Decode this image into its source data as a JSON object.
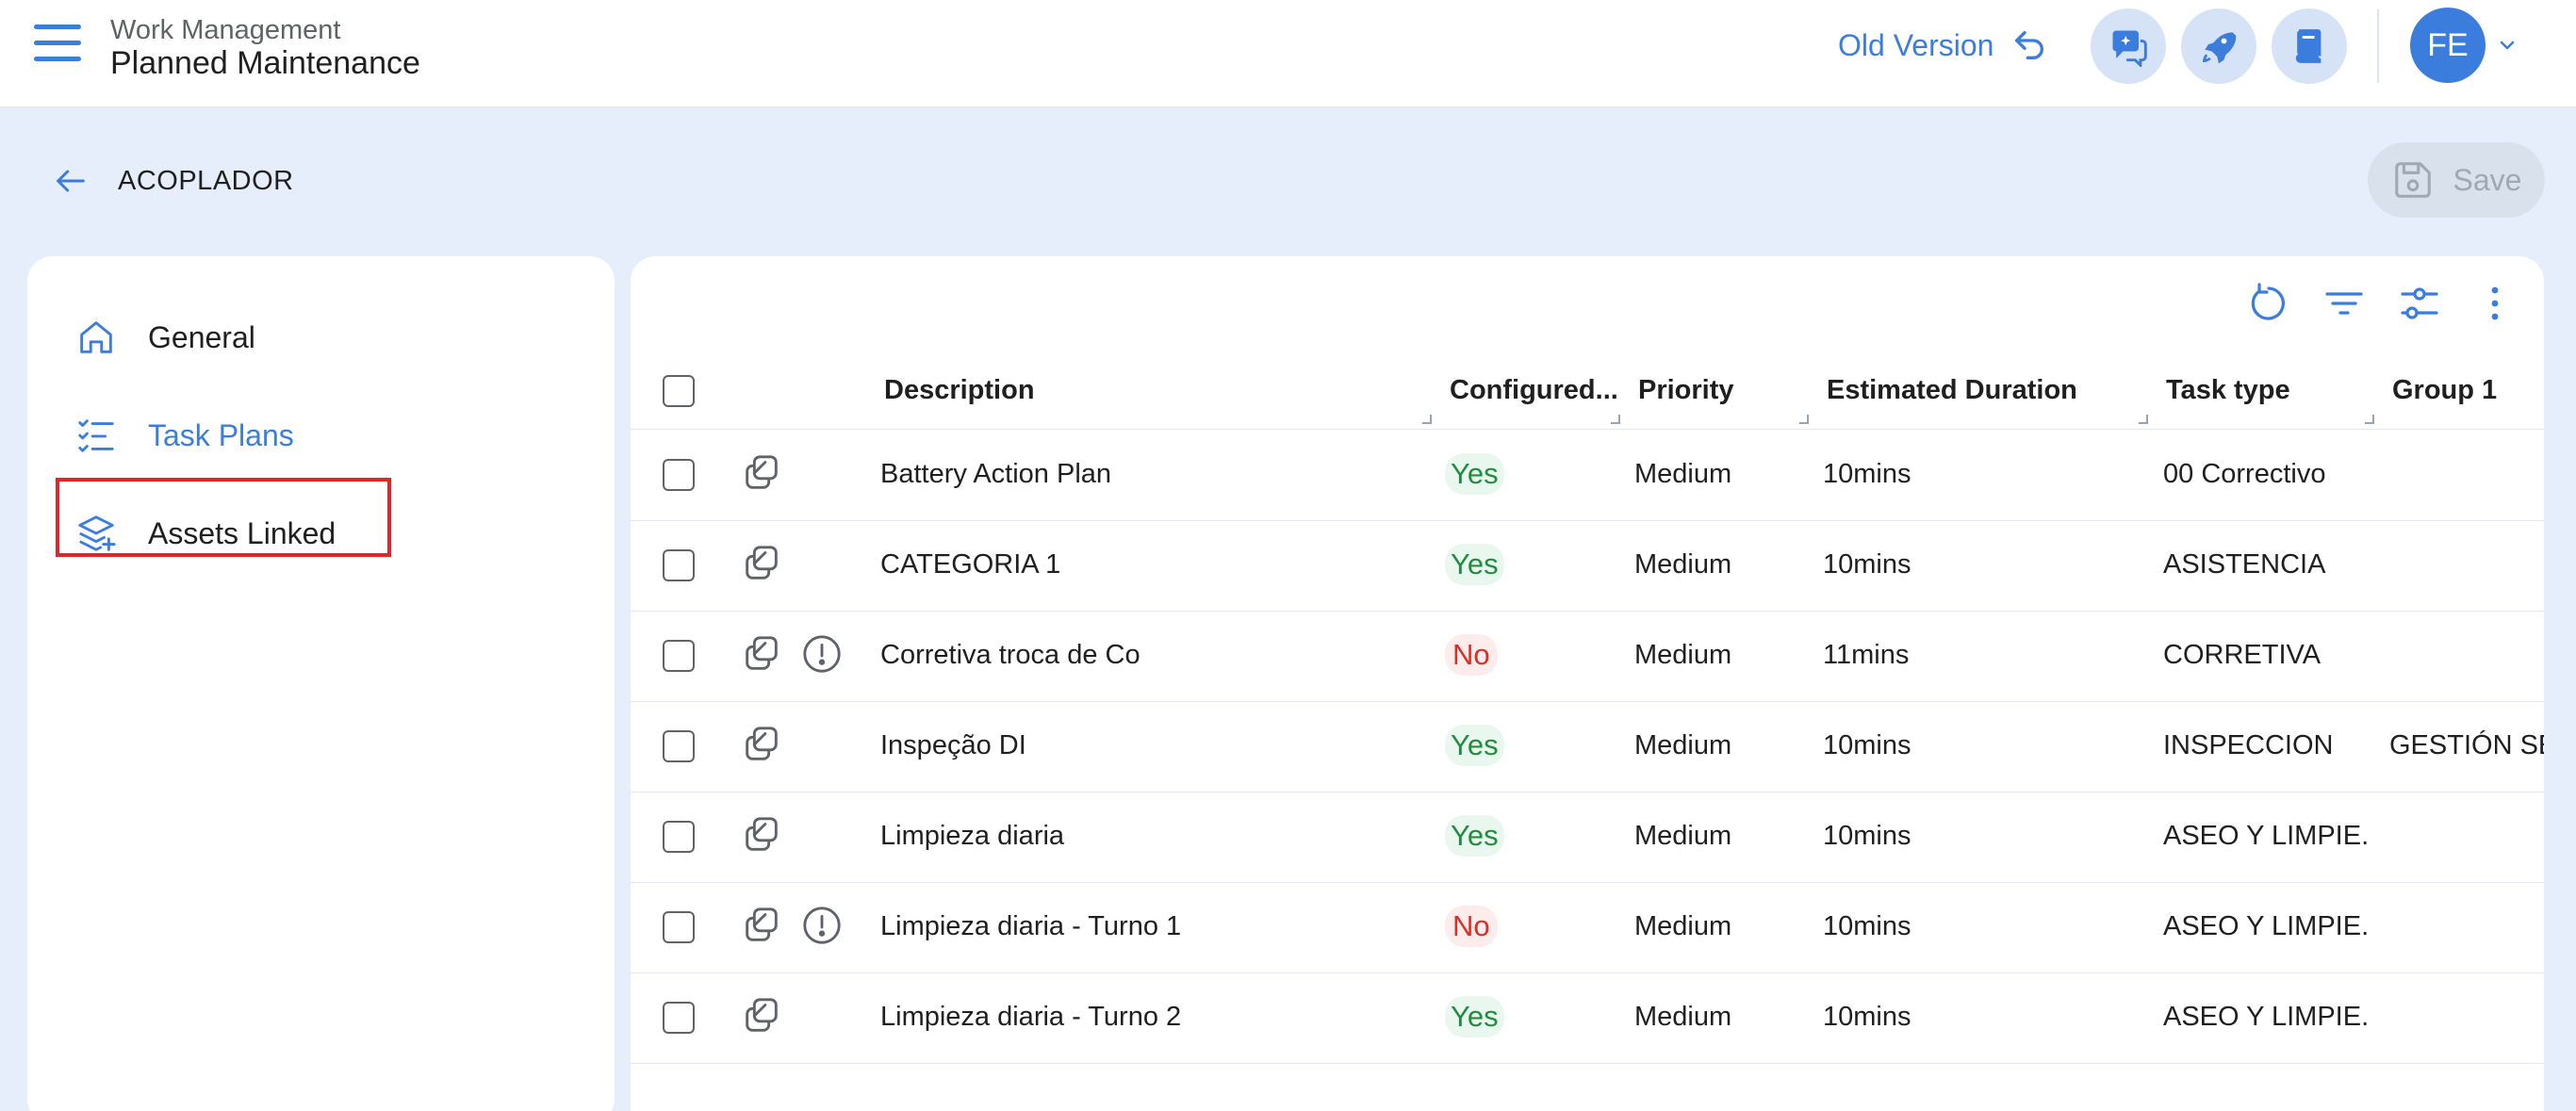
{
  "header": {
    "module": "Work Management",
    "title": "Planned Maintenance",
    "old_version_label": "Old Version",
    "avatar_initials": "FE"
  },
  "page": {
    "asset_name": "ACOPLADOR",
    "save_label": "Save"
  },
  "sidebar": {
    "items": [
      {
        "label": "General",
        "icon": "home-icon",
        "active": false
      },
      {
        "label": "Task Plans",
        "icon": "checklist-icon",
        "active": true
      },
      {
        "label": "Assets Linked",
        "icon": "layers-icon",
        "active": false
      }
    ]
  },
  "table": {
    "columns": [
      "Description",
      "Configured...",
      "Priority",
      "Estimated Duration",
      "Task type",
      "Group 1"
    ],
    "rows": [
      {
        "description": "Battery Action Plan",
        "configured": "Yes",
        "priority": "Medium",
        "duration": "10mins",
        "task_type": "00 Correctivo",
        "group1": "",
        "warning": false
      },
      {
        "description": "CATEGORIA 1",
        "configured": "Yes",
        "priority": "Medium",
        "duration": "10mins",
        "task_type": "ASISTENCIA",
        "group1": "",
        "warning": false
      },
      {
        "description": "Corretiva troca de Co",
        "configured": "No",
        "priority": "Medium",
        "duration": "11mins",
        "task_type": "CORRETIVA",
        "group1": "",
        "warning": true
      },
      {
        "description": "Inspeção DI",
        "configured": "Yes",
        "priority": "Medium",
        "duration": "10mins",
        "task_type": "INSPECCION",
        "group1": "GESTIÓN SEF",
        "warning": false
      },
      {
        "description": "Limpieza diaria",
        "configured": "Yes",
        "priority": "Medium",
        "duration": "10mins",
        "task_type": "ASEO Y LIMPIE...",
        "group1": "",
        "warning": false
      },
      {
        "description": "Limpieza diaria - Turno 1",
        "configured": "No",
        "priority": "Medium",
        "duration": "10mins",
        "task_type": "ASEO Y LIMPIE...",
        "group1": "",
        "warning": true
      },
      {
        "description": "Limpieza diaria - Turno 2",
        "configured": "Yes",
        "priority": "Medium",
        "duration": "10mins",
        "task_type": "ASEO Y LIMPIE...",
        "group1": "",
        "warning": false
      }
    ]
  },
  "colors": {
    "accent": "#3b7ddd",
    "yes": "#1e8e3e",
    "no": "#d93025",
    "highlight": "#e0262b"
  }
}
